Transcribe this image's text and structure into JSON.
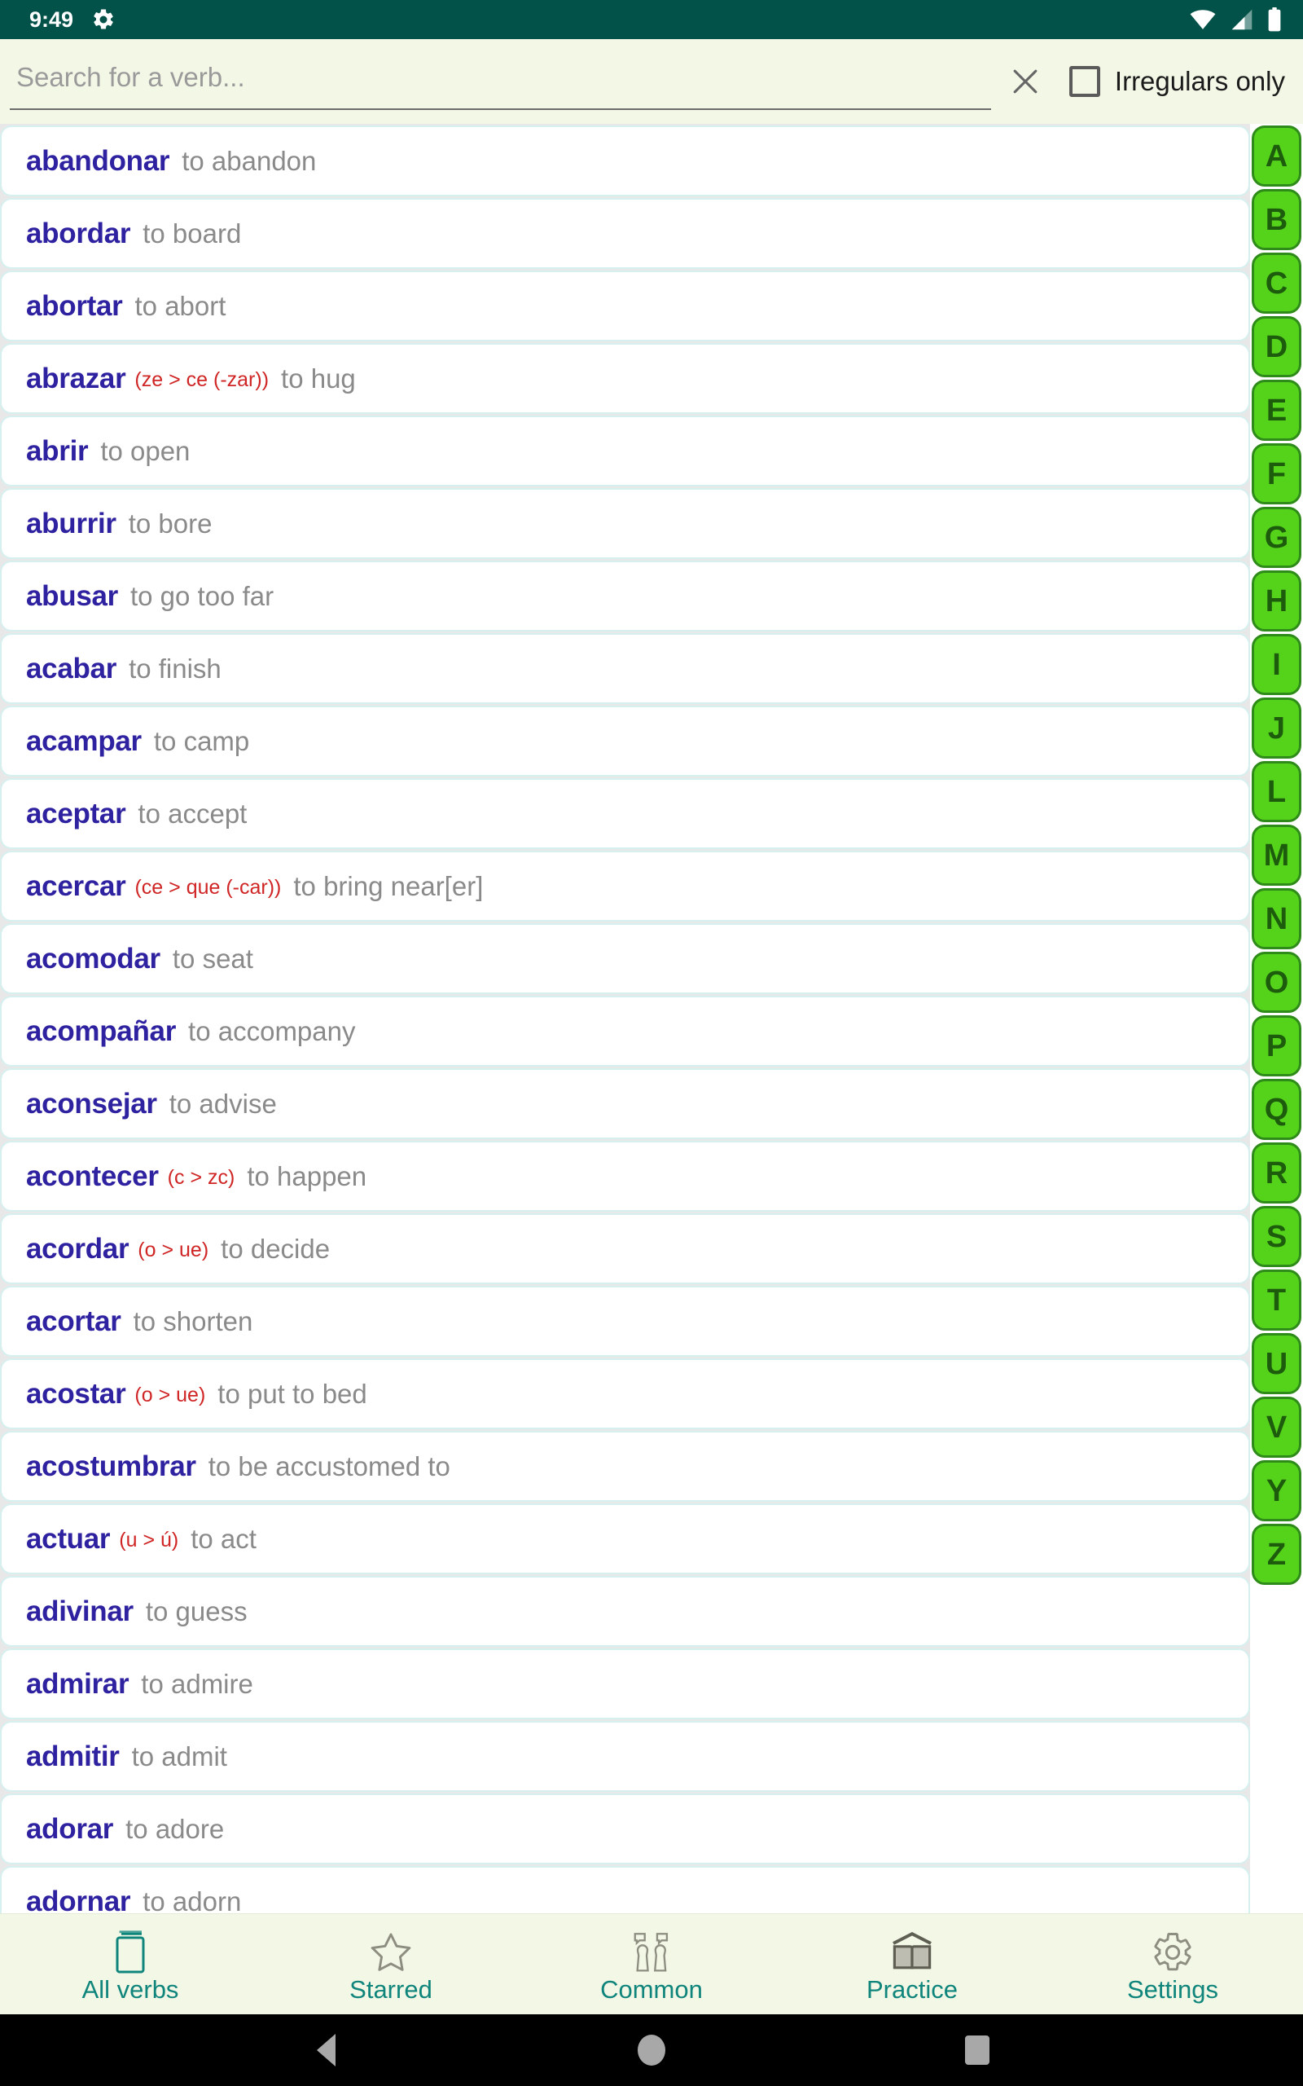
{
  "status_bar": {
    "clock": "9:49",
    "icons": [
      "gear-icon",
      "wifi-icon",
      "cellular-signal-icon",
      "battery-icon"
    ],
    "background_color": "#035249"
  },
  "search": {
    "placeholder": "Search for a verb...",
    "value": "",
    "clear_icon": "close-x-icon",
    "irregulars_label": "Irregulars only",
    "irregulars_checked": false
  },
  "verbs": [
    {
      "verb": "abandonar",
      "irregular": "",
      "translation": "to abandon"
    },
    {
      "verb": "abordar",
      "irregular": "",
      "translation": "to board"
    },
    {
      "verb": "abortar",
      "irregular": "",
      "translation": "to abort"
    },
    {
      "verb": "abrazar",
      "irregular": "(ze > ce (-zar))",
      "translation": "to hug"
    },
    {
      "verb": "abrir",
      "irregular": "",
      "translation": "to open"
    },
    {
      "verb": "aburrir",
      "irregular": "",
      "translation": "to bore"
    },
    {
      "verb": "abusar",
      "irregular": "",
      "translation": "to go too far"
    },
    {
      "verb": "acabar",
      "irregular": "",
      "translation": "to finish"
    },
    {
      "verb": "acampar",
      "irregular": "",
      "translation": "to camp"
    },
    {
      "verb": "aceptar",
      "irregular": "",
      "translation": "to accept"
    },
    {
      "verb": "acercar",
      "irregular": "(ce > que (-car))",
      "translation": "to bring near[er]"
    },
    {
      "verb": "acomodar",
      "irregular": "",
      "translation": "to seat"
    },
    {
      "verb": "acompañar",
      "irregular": "",
      "translation": "to accompany"
    },
    {
      "verb": "aconsejar",
      "irregular": "",
      "translation": "to advise"
    },
    {
      "verb": "acontecer",
      "irregular": "(c > zc)",
      "translation": "to happen"
    },
    {
      "verb": "acordar",
      "irregular": "(o > ue)",
      "translation": "to decide"
    },
    {
      "verb": "acortar",
      "irregular": "",
      "translation": "to shorten"
    },
    {
      "verb": "acostar",
      "irregular": "(o > ue)",
      "translation": "to put to bed"
    },
    {
      "verb": "acostumbrar",
      "irregular": "",
      "translation": "to be accustomed to"
    },
    {
      "verb": "actuar",
      "irregular": "(u > ú)",
      "translation": "to act"
    },
    {
      "verb": "adivinar",
      "irregular": "",
      "translation": "to guess"
    },
    {
      "verb": "admirar",
      "irregular": "",
      "translation": "to admire"
    },
    {
      "verb": "admitir",
      "irregular": "",
      "translation": "to admit"
    },
    {
      "verb": "adorar",
      "irregular": "",
      "translation": "to adore"
    },
    {
      "verb": "adornar",
      "irregular": "",
      "translation": "to adorn"
    }
  ],
  "alphabet_index": {
    "letters": [
      "A",
      "B",
      "C",
      "D",
      "E",
      "F",
      "G",
      "H",
      "I",
      "J",
      "L",
      "M",
      "N",
      "O",
      "P",
      "Q",
      "R",
      "S",
      "T",
      "U",
      "V",
      "Y",
      "Z"
    ],
    "button_color": "#55d31a",
    "text_color": "#1d5c0d"
  },
  "bottom_nav": {
    "items": [
      {
        "label": "All verbs",
        "icon": "book-closed-icon",
        "active": true
      },
      {
        "label": "Starred",
        "icon": "star-icon",
        "active": false
      },
      {
        "label": "Common",
        "icon": "people-talking-icon",
        "active": false
      },
      {
        "label": "Practice",
        "icon": "open-book-icon",
        "active": false
      },
      {
        "label": "Settings",
        "icon": "gear-icon",
        "active": false
      }
    ],
    "accent_color": "#0f857c"
  },
  "android_nav": {
    "buttons": [
      {
        "name": "back-button",
        "icon": "triangle-back-icon"
      },
      {
        "name": "home-button",
        "icon": "circle-home-icon"
      },
      {
        "name": "recents-button",
        "icon": "square-recents-icon"
      }
    ]
  }
}
